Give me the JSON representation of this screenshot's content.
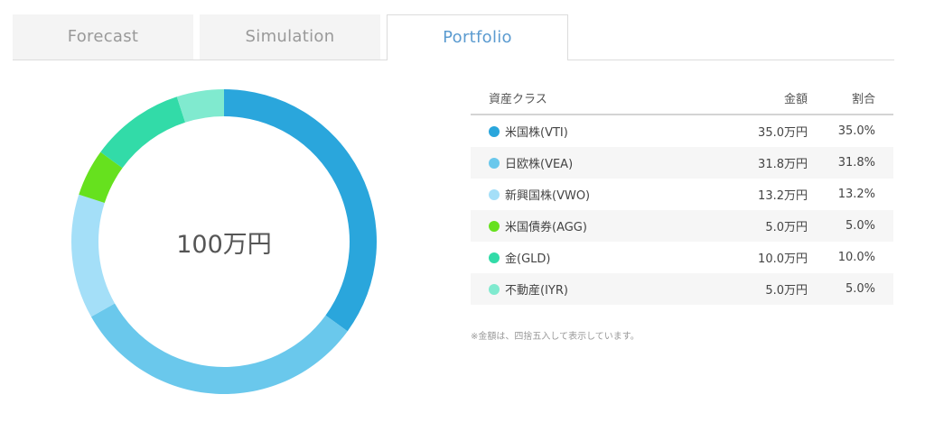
{
  "tabs": [
    {
      "label": "Forecast",
      "active": false
    },
    {
      "label": "Simulation",
      "active": false
    },
    {
      "label": "Portfolio",
      "active": true
    }
  ],
  "colors": {
    "accent": "#5b9bd0"
  },
  "donut": {
    "center_label": "100万円"
  },
  "table": {
    "headers": {
      "name": "資産クラス",
      "amount": "金額",
      "ratio": "割合"
    },
    "rows": [
      {
        "name": "米国株(VTI)",
        "amount": "35.0万円",
        "ratio": "35.0%",
        "color": "#2aa6dc"
      },
      {
        "name": "日欧株(VEA)",
        "amount": "31.8万円",
        "ratio": "31.8%",
        "color": "#6ac8ec"
      },
      {
        "name": "新興国株(VWO)",
        "amount": "13.2万円",
        "ratio": "13.2%",
        "color": "#a4dff8"
      },
      {
        "name": "米国債券(AGG)",
        "amount": "5.0万円",
        "ratio": "5.0%",
        "color": "#66e11e"
      },
      {
        "name": "金(GLD)",
        "amount": "10.0万円",
        "ratio": "10.0%",
        "color": "#32dba8"
      },
      {
        "name": "不動産(IYR)",
        "amount": "5.0万円",
        "ratio": "5.0%",
        "color": "#80eacf"
      }
    ]
  },
  "chart_data": {
    "type": "pie",
    "center_label": "100万円",
    "categories": [
      "米国株(VTI)",
      "日欧株(VEA)",
      "新興国株(VWO)",
      "米国債券(AGG)",
      "金(GLD)",
      "不動産(IYR)"
    ],
    "values": [
      35.0,
      31.8,
      13.2,
      5.0,
      10.0,
      5.0
    ],
    "colors": [
      "#2aa6dc",
      "#6ac8ec",
      "#a4dff8",
      "#66e11e",
      "#32dba8",
      "#80eacf"
    ]
  },
  "note": "※金額は、四捨五入して表示しています。"
}
